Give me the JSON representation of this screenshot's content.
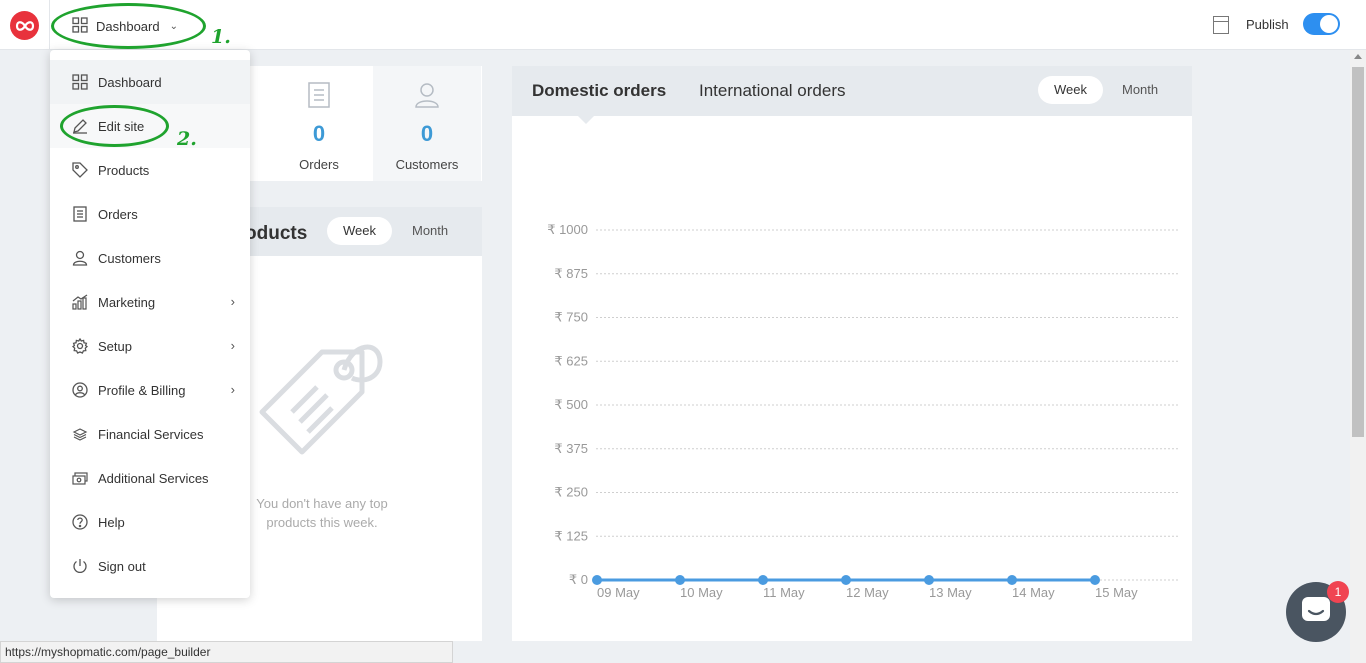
{
  "topbar": {
    "dashboard_label": "Dashboard",
    "publish_label": "Publish",
    "publish_on": true,
    "annotation_1": "1.",
    "annotation_2": "2."
  },
  "menu": {
    "items": [
      {
        "label": "Dashboard",
        "icon": "grid-icon"
      },
      {
        "label": "Edit site",
        "icon": "pencil-icon"
      },
      {
        "label": "Products",
        "icon": "tag-icon"
      },
      {
        "label": "Orders",
        "icon": "document-icon"
      },
      {
        "label": "Customers",
        "icon": "user-icon"
      },
      {
        "label": "Marketing",
        "icon": "chart-icon",
        "submenu": true
      },
      {
        "label": "Setup",
        "icon": "gear-icon",
        "submenu": true
      },
      {
        "label": "Profile & Billing",
        "icon": "user-circle-icon",
        "submenu": true
      },
      {
        "label": "Financial Services",
        "icon": "money-icon"
      },
      {
        "label": "Additional Services",
        "icon": "services-icon"
      },
      {
        "label": "Help",
        "icon": "help-icon"
      },
      {
        "label": "Sign out",
        "icon": "power-icon"
      }
    ]
  },
  "stats": {
    "orders_value": "0",
    "orders_label": "Orders",
    "customers_value": "0",
    "customers_label": "Customers"
  },
  "top_products": {
    "title": "oducts",
    "week_label": "Week",
    "month_label": "Month",
    "empty_text": "You don't have any top products this week."
  },
  "orders_panel": {
    "tab_domestic": "Domestic orders",
    "tab_international": "International orders",
    "week_label": "Week",
    "month_label": "Month"
  },
  "chart_data": {
    "type": "line",
    "x": [
      "09 May",
      "10 May",
      "11 May",
      "12 May",
      "13 May",
      "14 May",
      "15 May"
    ],
    "series": [
      {
        "values": [
          0,
          0,
          0,
          0,
          0,
          0,
          0
        ],
        "color": "#4a9be0"
      }
    ],
    "y_ticks": [
      "₹ 0",
      "₹ 125",
      "₹ 250",
      "₹ 375",
      "₹ 500",
      "₹ 625",
      "₹ 750",
      "₹ 875",
      "₹ 1000"
    ],
    "ylim": [
      0,
      1000
    ],
    "grid": true
  },
  "statusbar": {
    "url": "https://myshopmatic.com/page_builder"
  },
  "chat": {
    "badge_count": "1"
  }
}
